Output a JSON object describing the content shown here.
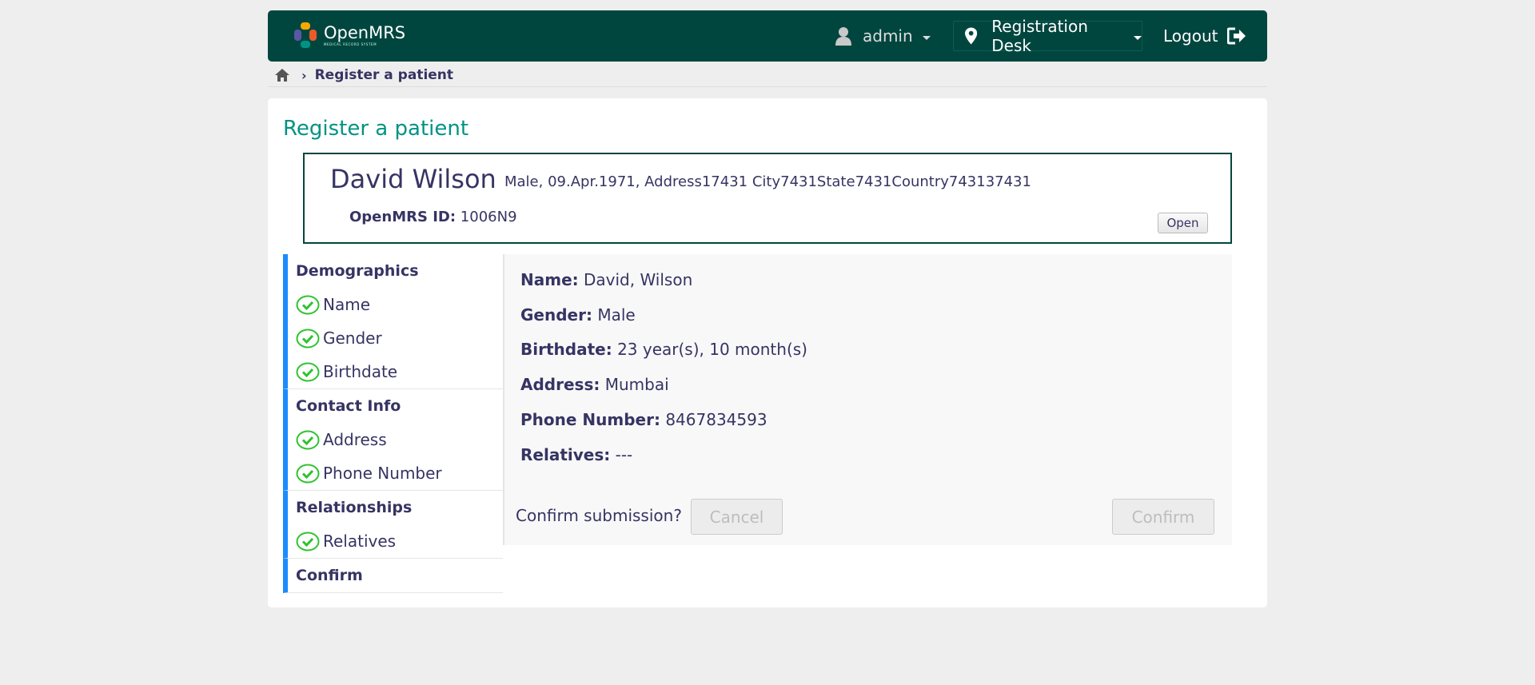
{
  "header": {
    "brand_name": "OpenMRS",
    "brand_sub": "MEDICAL RECORD SYSTEM",
    "user": "admin",
    "location": "Registration Desk",
    "logout": "Logout",
    "bg_color": "#00463f"
  },
  "breadcrumb": {
    "home_icon": "home-icon",
    "current": "Register a patient"
  },
  "page": {
    "title": "Register a patient"
  },
  "patient": {
    "name": "David Wilson",
    "info": "Male, 09.Apr.1971, Address17431 City7431State7431Country743137431",
    "id_label": "OpenMRS ID:",
    "id_value": "1006N9",
    "open_label": "Open"
  },
  "steps": {
    "sections": [
      {
        "title": "Demographics",
        "items": [
          "Name",
          "Gender",
          "Birthdate"
        ]
      },
      {
        "title": "Contact Info",
        "items": [
          "Address",
          "Phone Number"
        ]
      },
      {
        "title": "Relationships",
        "items": [
          "Relatives"
        ]
      },
      {
        "title": "Confirm",
        "items": []
      }
    ],
    "accent_color": "#1a8cff",
    "check_color": "#2ec32e"
  },
  "summary": {
    "fields": [
      {
        "label": "Name:",
        "value": "David, Wilson"
      },
      {
        "label": "Gender:",
        "value": "Male"
      },
      {
        "label": "Birthdate:",
        "value": "23 year(s), 10 month(s)"
      },
      {
        "label": "Address:",
        "value": "Mumbai"
      },
      {
        "label": "Phone Number:",
        "value": "8467834593"
      },
      {
        "label": "Relatives:",
        "value": "---"
      }
    ],
    "confirm_question": "Confirm submission?",
    "cancel_label": "Cancel",
    "confirm_label": "Confirm"
  }
}
